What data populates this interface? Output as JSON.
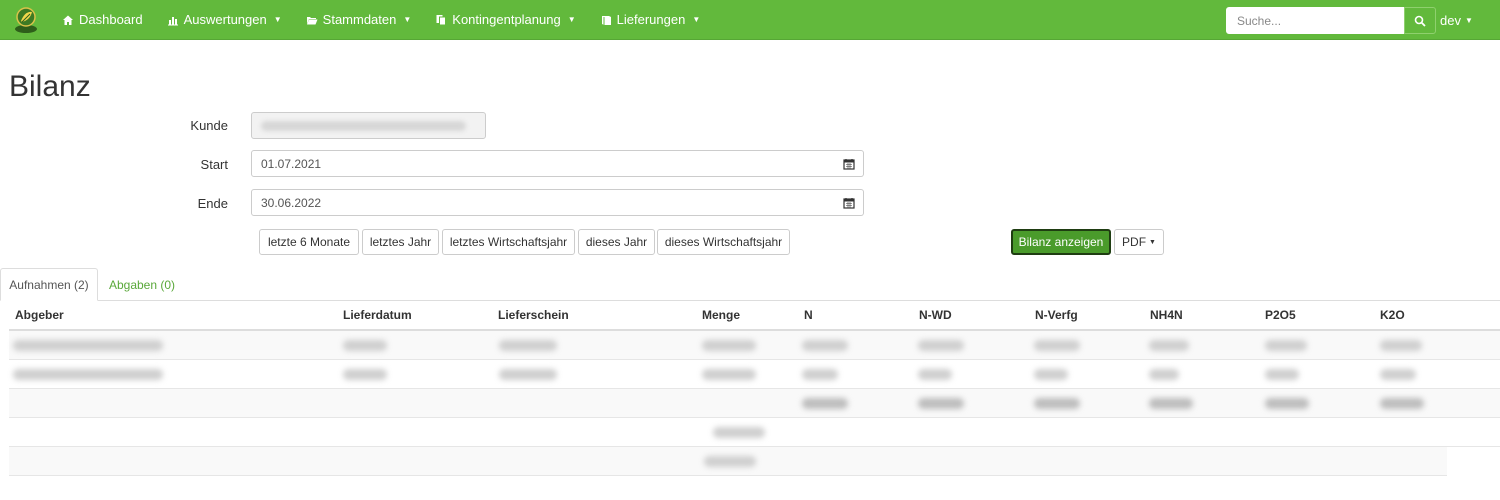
{
  "navbar": {
    "items": [
      {
        "label": "Dashboard",
        "icon": "home-icon",
        "has_caret": false
      },
      {
        "label": "Auswertungen",
        "icon": "bar-chart-icon",
        "has_caret": true
      },
      {
        "label": "Stammdaten",
        "icon": "folder-open-icon",
        "has_caret": true
      },
      {
        "label": "Kontingentplanung",
        "icon": "copy-icon",
        "has_caret": true
      },
      {
        "label": "Lieferungen",
        "icon": "book-icon",
        "has_caret": true
      }
    ],
    "search_placeholder": "Suche...",
    "user": "dev"
  },
  "page": {
    "title": "Bilanz"
  },
  "form": {
    "kunde_label": "Kunde",
    "start_label": "Start",
    "start_value": "01.07.2021",
    "ende_label": "Ende",
    "ende_value": "30.06.2022"
  },
  "quick_buttons": [
    "letzte 6 Monate",
    "letztes Jahr",
    "letztes Wirtschaftsjahr",
    "dieses Jahr",
    "dieses Wirtschaftsjahr"
  ],
  "actions": {
    "show": "Bilanz anzeigen",
    "pdf": "PDF"
  },
  "tabs": [
    {
      "label": "Aufnahmen (2)",
      "active": true
    },
    {
      "label": "Abgaben (0)",
      "active": false
    }
  ],
  "table": {
    "columns": [
      "Abgeber",
      "Lieferdatum",
      "Lieferschein",
      "Menge",
      "N",
      "N-WD",
      "N-Verfg",
      "NH4N",
      "P2O5",
      "K2O"
    ]
  },
  "colors": {
    "brand": "#62b93c",
    "primary_button": "#4a9b2b",
    "tab_link": "#5aa83a"
  }
}
